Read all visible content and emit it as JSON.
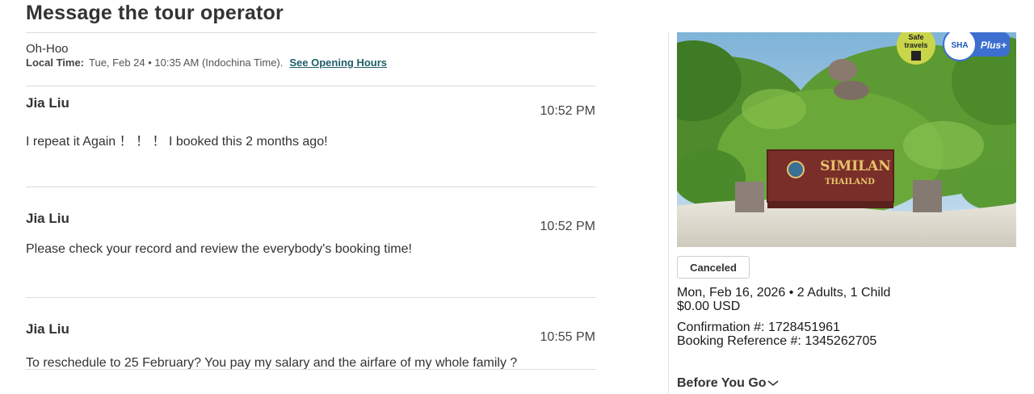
{
  "page": {
    "title": "Message the tour operator"
  },
  "operator": {
    "name": "Oh-Hoo",
    "local_time_label": "Local Time:",
    "local_time_value": "Tue, Feb 24 • 10:35 AM (Indochina Time).",
    "opening_hours_link": "See Opening Hours"
  },
  "messages": [
    {
      "author": "Jia Liu",
      "time": "10:52 PM",
      "text": "I repeat it Again ！ ！ ！ I booked this 2 months ago!"
    },
    {
      "author": "Jia Liu",
      "time": "10:52 PM",
      "text": "Please check your record and review the everybody's booking time!"
    },
    {
      "author": "Jia Liu",
      "time": "10:55 PM",
      "text": "To reschedule to 25 February?  You pay my salary and the airfare of my whole family ?"
    }
  ],
  "booking": {
    "image": {
      "sign_line1": "SIMILAN",
      "sign_line2": "THAILAND",
      "badge_safe_line1": "Safe",
      "badge_safe_line2": "travels",
      "badge_sha": "SHA",
      "badge_plus": "Plus+"
    },
    "status": "Canceled",
    "date_guests": "Mon, Feb 16, 2026 • 2 Adults, 1 Child",
    "price": "$0.00 USD",
    "confirmation": "Confirmation #: 1728451961",
    "booking_reference": "Booking Reference #: 1345262705",
    "before_you_go": "Before You Go"
  },
  "icons": {
    "expand": "chevron-down-icon"
  },
  "colors": {
    "link": "#1f5f6b",
    "sign": "#7a2e2a",
    "sign_text": "#e7c36a"
  }
}
